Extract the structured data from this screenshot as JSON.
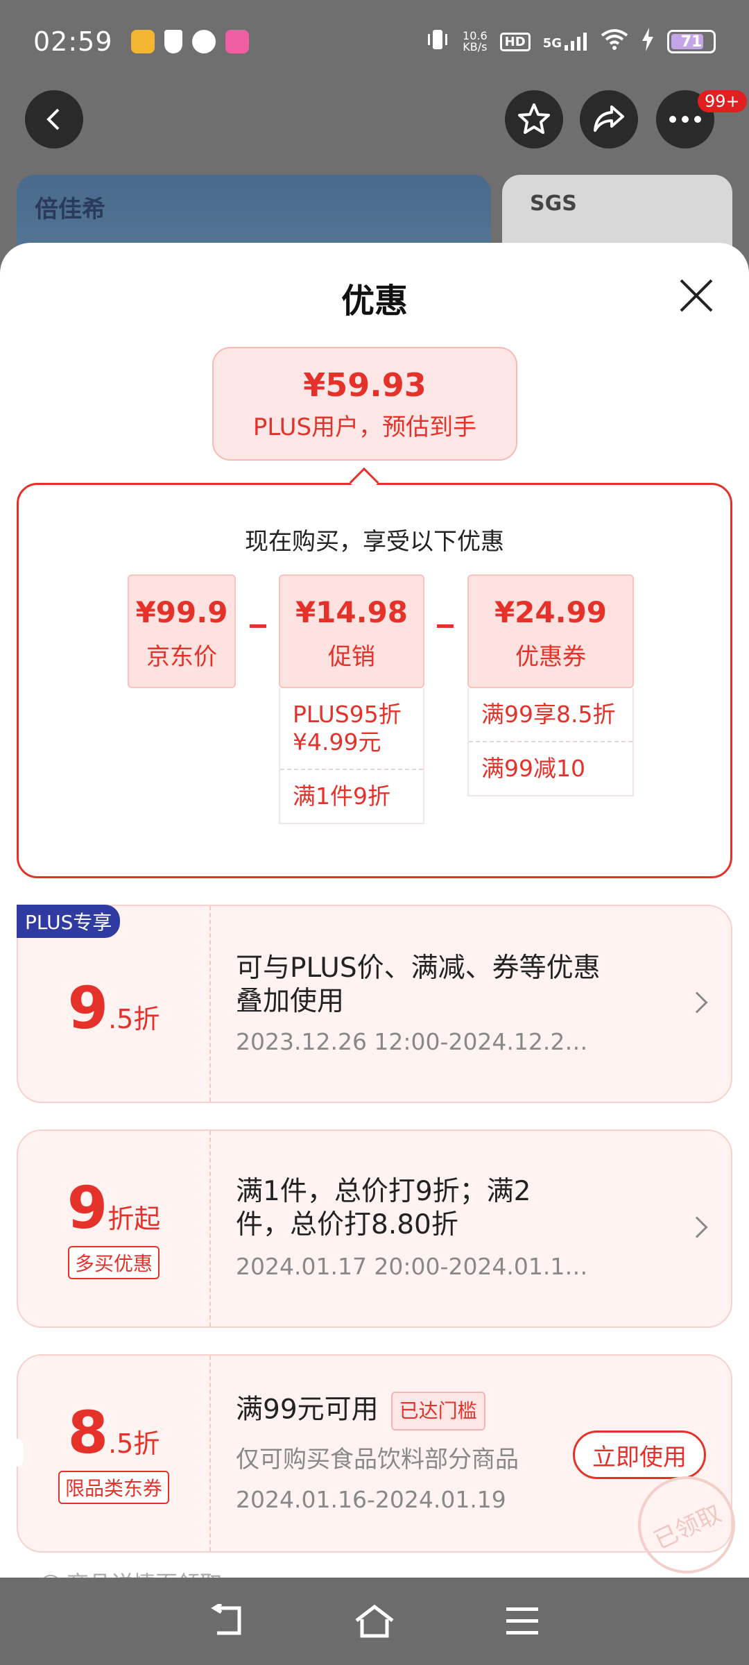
{
  "status_bar": {
    "time": "02:59",
    "net_speed_value": "10.6",
    "net_speed_unit": "KB/s",
    "hd_label": "HD",
    "network": "5G",
    "battery": "71"
  },
  "top_nav": {
    "badge": "99+"
  },
  "background": {
    "brand_text": "倍佳希",
    "sgs_text": "SGS"
  },
  "sheet": {
    "title": "优惠",
    "estimate": {
      "price": "¥59.93",
      "label": "PLUS用户，预估到手"
    },
    "calc": {
      "title": "现在购买，享受以下优惠",
      "jd_price": {
        "value": "¥99.9",
        "label": "京东价"
      },
      "promotion": {
        "value": "¥14.98",
        "label": "促销",
        "items": [
          "PLUS95折 ¥4.99元",
          "满1件9折"
        ]
      },
      "coupon": {
        "value": "¥24.99",
        "label": "优惠券",
        "items": [
          "满99享8.5折",
          "满99减10"
        ]
      }
    },
    "coupons": [
      {
        "badge": "PLUS专享",
        "discount_big": "9",
        "discount_small": ".5折",
        "desc": "可与PLUS价、满减、券等优惠叠加使用",
        "date": "2023.12.26 12:00-2024.12.2…"
      },
      {
        "discount_big": "9",
        "discount_small": "折起",
        "tag": "多买优惠",
        "desc": "满1件，总价打9折；满2件，总价打8.80折",
        "date": "2024.01.17 20:00-2024.01.1…"
      },
      {
        "discount_big": "8",
        "discount_small": ".5折",
        "tag": "限品类东券",
        "title": "满99元可用",
        "reached": "已达门槛",
        "desc": "仅可购买食品饮料部分商品",
        "date": "2024.01.16-2024.01.19",
        "button": "立即使用",
        "stamp": "已领取"
      }
    ],
    "more_text": "商品详情页领取"
  }
}
